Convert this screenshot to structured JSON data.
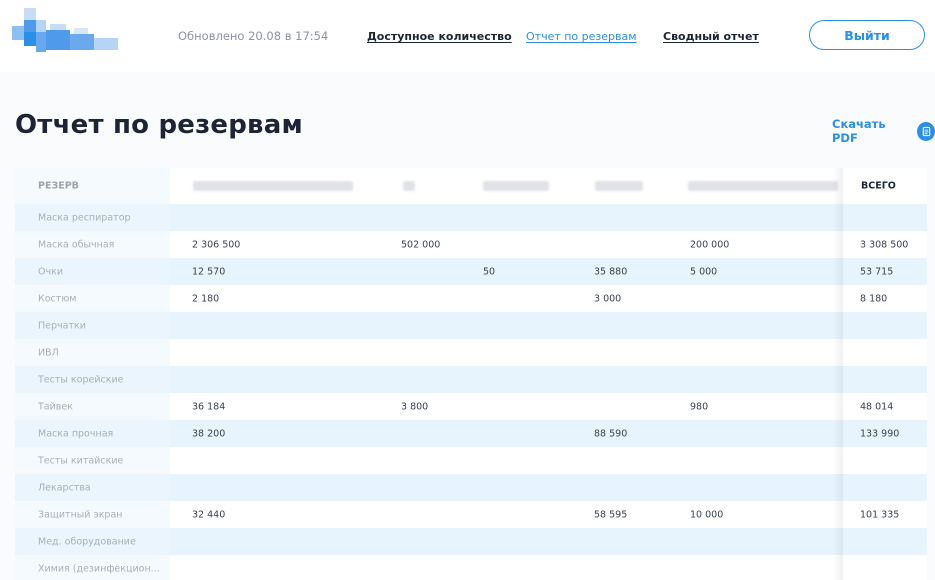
{
  "header": {
    "updated": "Обновлено 20.08 в 17:54",
    "nav": [
      {
        "label": "Доступное количество",
        "active": false
      },
      {
        "label": "Отчет по резервам",
        "active": true
      },
      {
        "label": "Сводный отчет",
        "active": false
      }
    ],
    "logout_label": "Выйти"
  },
  "page": {
    "title": "Отчет по резервам",
    "pdf_label": "Скачать PDF"
  },
  "table": {
    "col_first": "РЕЗЕРВ",
    "col_last": "ВСЕГО",
    "rows": [
      {
        "name": "Маска респиратор",
        "c1": "",
        "c2": "",
        "c3": "",
        "c4": "",
        "c5": "",
        "total": ""
      },
      {
        "name": "Маска обычная",
        "c1": "2 306 500",
        "c2": "502 000",
        "c3": "",
        "c4": "",
        "c5": "200 000",
        "total": "3 308 500"
      },
      {
        "name": "Очки",
        "c1": "12 570",
        "c2": "",
        "c3": "50",
        "c4": "35 880",
        "c5": "5 000",
        "total": "53 715"
      },
      {
        "name": "Костюм",
        "c1": "2 180",
        "c2": "",
        "c3": "",
        "c4": "3 000",
        "c5": "",
        "total": "8 180"
      },
      {
        "name": "Перчатки",
        "c1": "",
        "c2": "",
        "c3": "",
        "c4": "",
        "c5": "",
        "total": ""
      },
      {
        "name": "ИВЛ",
        "c1": "",
        "c2": "",
        "c3": "",
        "c4": "",
        "c5": "",
        "total": ""
      },
      {
        "name": "Тесты корейские",
        "c1": "",
        "c2": "",
        "c3": "",
        "c4": "",
        "c5": "",
        "total": ""
      },
      {
        "name": "Тайвек",
        "c1": "36 184",
        "c2": "3 800",
        "c3": "",
        "c4": "",
        "c5": "980",
        "total": "48 014"
      },
      {
        "name": "Маска прочная",
        "c1": "38 200",
        "c2": "",
        "c3": "",
        "c4": "88 590",
        "c5": "",
        "total": "133 990"
      },
      {
        "name": "Тесты китайские",
        "c1": "",
        "c2": "",
        "c3": "",
        "c4": "",
        "c5": "",
        "total": ""
      },
      {
        "name": "Лекарства",
        "c1": "",
        "c2": "",
        "c3": "",
        "c4": "",
        "c5": "",
        "total": ""
      },
      {
        "name": "Защитный экран",
        "c1": "32 440",
        "c2": "",
        "c3": "",
        "c4": "58 595",
        "c5": "10 000",
        "total": "101 335"
      },
      {
        "name": "Мед. оборудование",
        "c1": "",
        "c2": "",
        "c3": "",
        "c4": "",
        "c5": "",
        "total": ""
      },
      {
        "name": "Химия (дезинфекцион...",
        "c1": "",
        "c2": "",
        "c3": "",
        "c4": "",
        "c5": "",
        "total": ""
      }
    ]
  },
  "colors": {
    "accent": "#2b8fe6",
    "row_stripe": "#e7f3fd",
    "title": "#1b2536"
  },
  "icons": {
    "pdf": "document-icon",
    "logo": "pixelated-logo"
  }
}
